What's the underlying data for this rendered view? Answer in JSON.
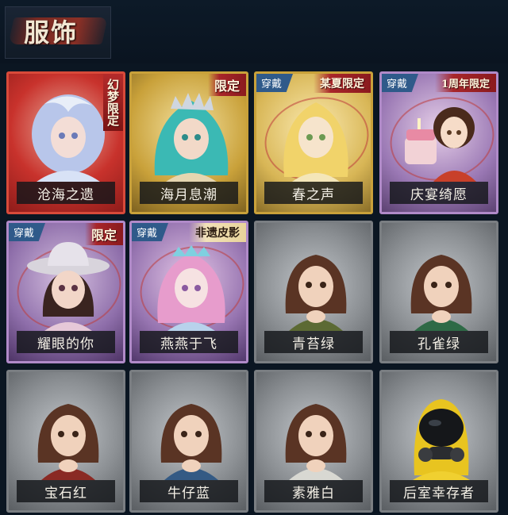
{
  "header": {
    "title": "服饰"
  },
  "wearing_tag": "穿戴",
  "costumes": [
    {
      "name": "沧海之遗",
      "ribbon": "幻梦限定",
      "ribbon_style": "vertical",
      "wearing": false,
      "frame": "red"
    },
    {
      "name": "海月息潮",
      "ribbon": "限定",
      "ribbon_style": "horizontal",
      "wearing": false,
      "frame": "gold"
    },
    {
      "name": "春之声",
      "ribbon": "某夏限定",
      "ribbon_style": "horizontal",
      "wearing": true,
      "frame": "gold"
    },
    {
      "name": "庆宴绮愿",
      "ribbon": "1周年限定",
      "ribbon_style": "horizontal",
      "wearing": true,
      "frame": "purple"
    },
    {
      "name": "耀眼的你",
      "ribbon": "限定",
      "ribbon_style": "horizontal",
      "wearing": true,
      "frame": "purple"
    },
    {
      "name": "燕燕于飞",
      "ribbon": "非遗皮影",
      "ribbon_style": "horizontal",
      "wearing": true,
      "frame": "purple"
    },
    {
      "name": "青苔绿",
      "ribbon": "",
      "wearing": false,
      "frame": "grey"
    },
    {
      "name": "孔雀绿",
      "ribbon": "",
      "wearing": false,
      "frame": "grey"
    },
    {
      "name": "宝石红",
      "ribbon": "",
      "wearing": false,
      "frame": "grey"
    },
    {
      "name": "牛仔蓝",
      "ribbon": "",
      "wearing": false,
      "frame": "grey"
    },
    {
      "name": "素雅白",
      "ribbon": "",
      "wearing": false,
      "frame": "grey"
    },
    {
      "name": "后室幸存者",
      "ribbon": "",
      "wearing": false,
      "frame": "grey"
    }
  ],
  "colors": {
    "background": "#0b1622",
    "frame_red": "#c8322c",
    "frame_gold": "#c9a13a",
    "frame_purple": "#8a6aa6",
    "frame_grey": "#6c7074",
    "wearing_tag": "#2f5a8a"
  }
}
